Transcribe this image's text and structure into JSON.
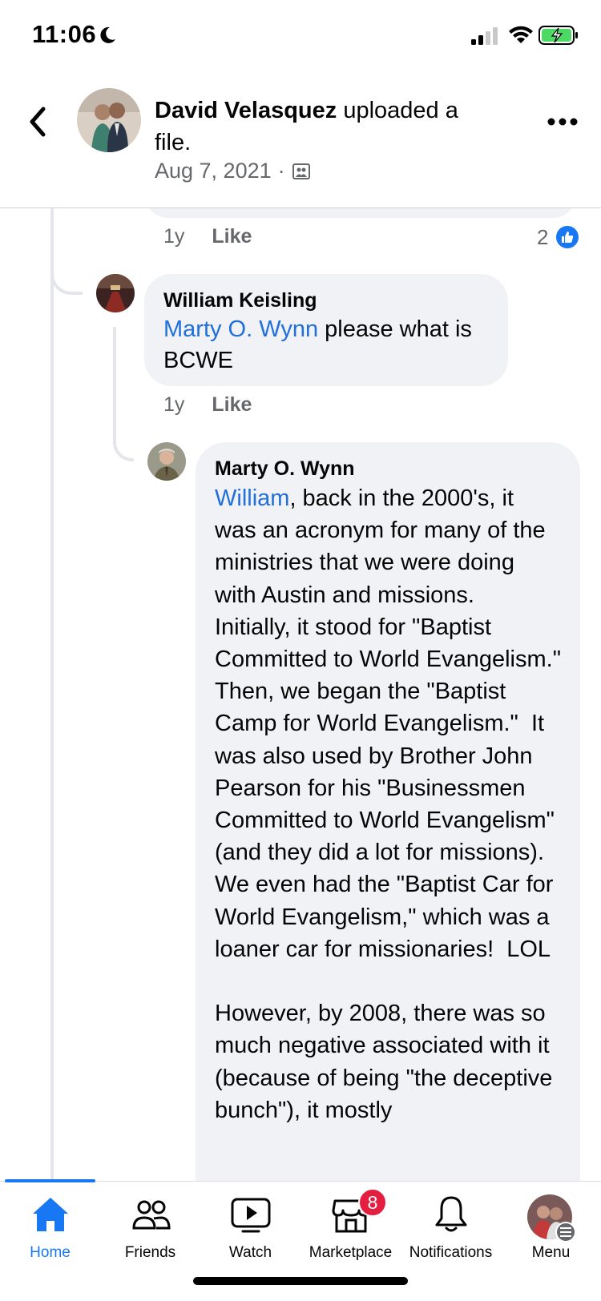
{
  "status_bar": {
    "time": "11:06"
  },
  "post": {
    "author": "David Velasquez",
    "action": " uploaded a file.",
    "date": "Aug 7, 2021",
    "meta_separator": "·",
    "privacy_icon": "album-icon"
  },
  "previous_comment": {
    "age": "1y",
    "like_label": "Like",
    "reaction_count": "2"
  },
  "comments": [
    {
      "name": "William Keisling",
      "mention": "Marty O. Wynn",
      "text": " please what is BCWE",
      "age": "1y",
      "like_label": "Like"
    },
    {
      "name": "Marty O. Wynn",
      "mention": "William",
      "text": ", back in the 2000's, it was an acronym for many of the ministries that we were doing with Austin and missions.  Initially, it stood for \"Baptist Committed to World Evangelism.\"  Then, we began the \"Baptist Camp for World Evangelism.\"  It was also used by Brother John Pearson for his \"Businessmen Committed to World Evangelism\" (and they did a lot for missions).  We even had the \"Baptist Car for World Evangelism,\" which was a loaner car for missionaries!  LOL\n\nHowever, by 2008, there was so much negative associated with it (because of being \"the deceptive bunch\"), it mostly"
    }
  ],
  "tabs": [
    {
      "label": "Home",
      "icon": "home-icon",
      "active": true
    },
    {
      "label": "Friends",
      "icon": "friends-icon"
    },
    {
      "label": "Watch",
      "icon": "watch-icon"
    },
    {
      "label": "Marketplace",
      "icon": "marketplace-icon",
      "badge": "8"
    },
    {
      "label": "Notifications",
      "icon": "bell-icon"
    },
    {
      "label": "Menu",
      "icon": "menu-avatar"
    }
  ],
  "colors": {
    "accent": "#1877f2",
    "mention": "#216fdb",
    "badge": "#e41e3f",
    "bubble": "#f0f2f5"
  }
}
